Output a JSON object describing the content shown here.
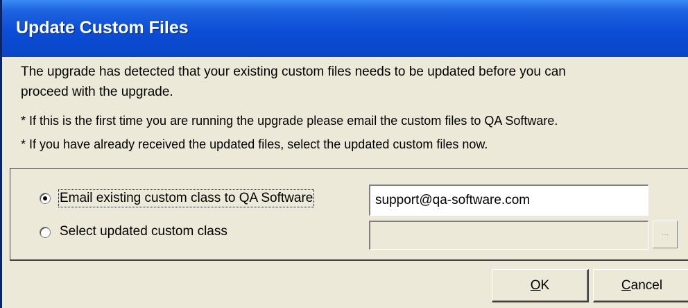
{
  "window": {
    "title": "Update Custom Files"
  },
  "message": {
    "line1": "The upgrade has detected that your existing custom files needs to be updated before you can",
    "line2": "proceed with the upgrade.",
    "bullet1": "* If this is the first time you are running the upgrade please email the custom files to QA Software.",
    "bullet2": "* If you have already received the updated files, select the updated custom files now."
  },
  "options": {
    "email": {
      "label": "Email existing custom class to QA Software",
      "selected": true,
      "value": "support@qa-software.com"
    },
    "select": {
      "label": "Select updated custom class",
      "selected": false,
      "value": "",
      "browse_label": "..."
    }
  },
  "buttons": {
    "ok_mnemonic": "O",
    "ok_rest": "K",
    "cancel_mnemonic": "C",
    "cancel_rest": "ancel"
  }
}
